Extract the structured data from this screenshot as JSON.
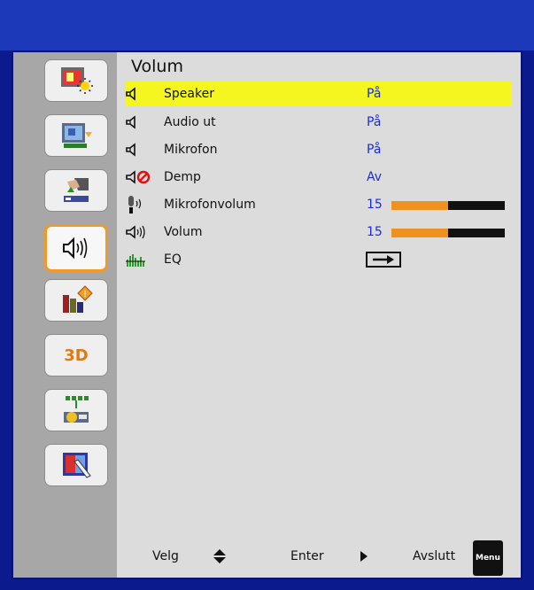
{
  "menu": {
    "title": "Volum",
    "items": [
      {
        "label": "Speaker",
        "value": "På",
        "icon": "speaker-icon",
        "selected": true
      },
      {
        "label": "Audio ut",
        "value": "På",
        "icon": "speaker-icon",
        "selected": false
      },
      {
        "label": "Mikrofon",
        "value": "På",
        "icon": "speaker-icon",
        "selected": false
      },
      {
        "label": "Demp",
        "value": "Av",
        "icon": "mute-icon",
        "selected": false
      },
      {
        "label": "Mikrofonvolum",
        "value": "15",
        "icon": "microphone-icon",
        "level_fraction": 0.5,
        "selected": false
      },
      {
        "label": "Volum",
        "value": "15",
        "icon": "volume-icon",
        "level_fraction": 0.5,
        "selected": false
      },
      {
        "label": "EQ",
        "value": "",
        "icon": "equalizer-icon",
        "selected": false
      }
    ]
  },
  "sidebar": {
    "items": [
      {
        "name": "image-settings",
        "icon": "image-settings-icon",
        "active": false
      },
      {
        "name": "display-settings",
        "icon": "display-settings-icon",
        "active": false
      },
      {
        "name": "setup",
        "icon": "setup-icon",
        "active": false
      },
      {
        "name": "volume",
        "icon": "volume-icon",
        "active": true
      },
      {
        "name": "info",
        "icon": "info-icon",
        "active": false
      },
      {
        "name": "3d",
        "icon": "3d-icon",
        "label": "3D",
        "active": false
      },
      {
        "name": "network",
        "icon": "network-icon",
        "active": false
      },
      {
        "name": "interactive",
        "icon": "interactive-icon",
        "active": false
      }
    ]
  },
  "footer": {
    "select_label": "Velg",
    "enter_label": "Enter",
    "exit_label": "Avslutt",
    "menu_key": "Menu"
  },
  "colors": {
    "accent": "#f19a28",
    "highlight": "#f5f520",
    "value_text": "#1a2cd6",
    "background": "#0b1a8c"
  }
}
